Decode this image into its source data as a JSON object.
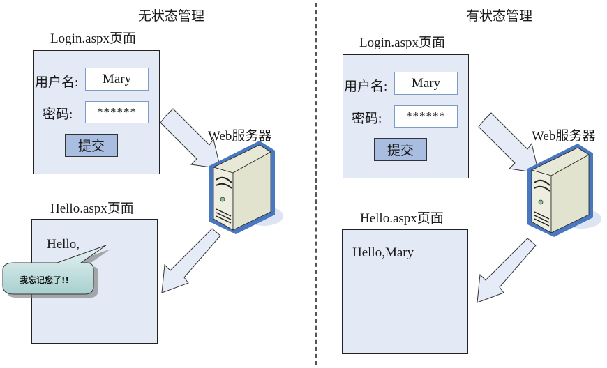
{
  "stateless": {
    "title": "无状态管理",
    "login_page": {
      "caption": "Login.aspx页面",
      "username_label": "用户名:",
      "username_value": "Mary",
      "password_label": "密码:",
      "password_value": "******",
      "submit_label": "提交"
    },
    "server_label": "Web服务器",
    "hello_page": {
      "caption": "Hello.aspx页面",
      "greeting": "Hello,"
    },
    "bubble_text": "我忘记您了!!"
  },
  "stateful": {
    "title": "有状态管理",
    "login_page": {
      "caption": "Login.aspx页面",
      "username_label": "用户名:",
      "username_value": "Mary",
      "password_label": "密码:",
      "password_value": "******",
      "submit_label": "提交"
    },
    "server_label": "Web服务器",
    "hello_page": {
      "caption": "Hello.aspx页面",
      "greeting": "Hello,Mary"
    }
  },
  "colors": {
    "page_fill": "#e4eaf5",
    "button_fill": "#a9bde0",
    "server_outline": "#4a78c0",
    "arrow_fill": "#e6ecf7"
  }
}
